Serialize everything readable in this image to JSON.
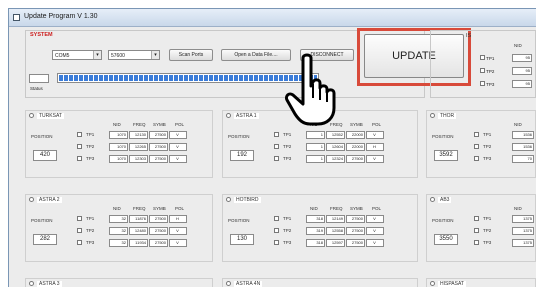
{
  "window": {
    "title": "Update Program V 1.30"
  },
  "system": {
    "label": "SYSTEM",
    "port_value": "COM5",
    "baud_value": "57600",
    "scan_ports_label": "Scan Ports",
    "open_file_label": "Open a Data File....",
    "disconnect_label": "DISCONNECT",
    "update_label": "UPDATE",
    "status_label": "Status",
    "progress_fraction": 1.0
  },
  "headers": {
    "nid": "NID",
    "freq": "FREQ",
    "symb": "SYMB",
    "pol": "POL",
    "position": "POSITION"
  },
  "tp_labels": [
    "TP1",
    "TP2",
    "TP3"
  ],
  "top_right": {
    "label_fragment": "IS",
    "nid": "NID",
    "rows": [
      "TP1",
      "TP2",
      "TP3"
    ],
    "values": [
      "95",
      "95",
      "95"
    ]
  },
  "satellites": {
    "turksat": {
      "name": "TURKSAT",
      "position": "420",
      "rows": [
        {
          "nid": "1070",
          "freq": "12130",
          "symb": "27500",
          "pol": "V"
        },
        {
          "nid": "1070",
          "freq": "12265",
          "symb": "27500",
          "pol": "V"
        },
        {
          "nid": "1070",
          "freq": "12303",
          "symb": "27500",
          "pol": "V"
        }
      ]
    },
    "astra1": {
      "name": "ASTRA 1",
      "position": "192",
      "rows": [
        {
          "nid": "1",
          "freq": "12552",
          "symb": "22000",
          "pol": "V"
        },
        {
          "nid": "1",
          "freq": "12604",
          "symb": "22000",
          "pol": "H"
        },
        {
          "nid": "1",
          "freq": "12324",
          "symb": "27500",
          "pol": "V"
        }
      ]
    },
    "thor": {
      "name": "THOR",
      "position": "3592",
      "nid_values": [
        "1536",
        "1536",
        "70"
      ]
    },
    "astra2": {
      "name": "ASTRA 2",
      "position": "282",
      "rows": [
        {
          "nid": "32",
          "freq": "11876",
          "symb": "27500",
          "pol": "H"
        },
        {
          "nid": "32",
          "freq": "12480",
          "symb": "27500",
          "pol": "V"
        },
        {
          "nid": "32",
          "freq": "11934",
          "symb": "27500",
          "pol": "V"
        }
      ]
    },
    "hotbird": {
      "name": "HOTBIRD",
      "position": "130",
      "rows": [
        {
          "nid": "318",
          "freq": "12149",
          "symb": "27500",
          "pol": "V"
        },
        {
          "nid": "319",
          "freq": "12558",
          "symb": "27500",
          "pol": "V"
        },
        {
          "nid": "318",
          "freq": "12597",
          "symb": "27500",
          "pol": "V"
        }
      ]
    },
    "ab3": {
      "name": "AB3",
      "position": "3550",
      "nid_values": [
        "1375",
        "1375",
        "1375"
      ]
    },
    "astra3": {
      "name": "ASTRA 3"
    },
    "astra4n": {
      "name": "ASTRA 4N"
    },
    "hispasat": {
      "name": "HISPASAT"
    }
  }
}
